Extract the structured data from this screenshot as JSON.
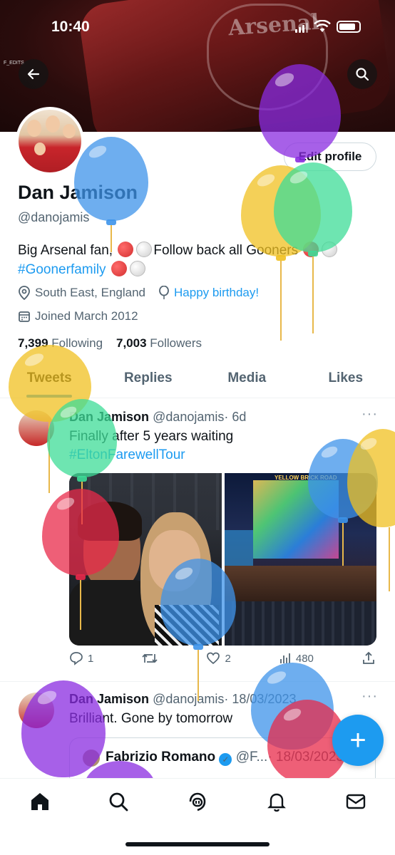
{
  "status_bar": {
    "time": "10:40"
  },
  "banner": {
    "crest_text": "Arsenal",
    "watermark": "F_EDITS"
  },
  "header": {
    "back_icon": "arrow-left-icon",
    "search_icon": "search-icon"
  },
  "profile": {
    "edit_profile_label": "Edit profile",
    "name": "Dan Jamison",
    "handle": "@danojamis",
    "bio_part1": "Big Arsenal fan,",
    "bio_part2": "Follow back all Gooners",
    "bio_hashtag": "#Goonerfamily",
    "location": "South East, England",
    "birthday": "Happy birthday!",
    "joined": "Joined March 2012",
    "following_count": "7,399",
    "following_label": "Following",
    "followers_count": "7,003",
    "followers_label": "Followers"
  },
  "tabs": [
    {
      "label": "Tweets",
      "active": true
    },
    {
      "label": "Replies",
      "active": false
    },
    {
      "label": "Media",
      "active": false
    },
    {
      "label": "Likes",
      "active": false
    }
  ],
  "tweets": [
    {
      "author": "Dan Jamison",
      "handle": "@danojamis",
      "time": "· 6d",
      "text": "Finally after 5 years waiting",
      "hashtag": "#EltonFarewellTour",
      "image_caption": "YELLOW BRICK ROAD",
      "replies": "1",
      "likes": "2",
      "views": "480"
    },
    {
      "author": "Dan Jamison",
      "handle": "@danojamis",
      "time": "· 18/03/2023",
      "text": "Brilliant. Gone by tomorrow",
      "quote": {
        "author": "Fabrizio Romano",
        "handle": "@F...",
        "time": "· 18/03/2023"
      }
    }
  ],
  "colors": {
    "accent": "#1d9bf0",
    "text": "#0f1419",
    "muted": "#536471"
  },
  "fab_label": "+"
}
